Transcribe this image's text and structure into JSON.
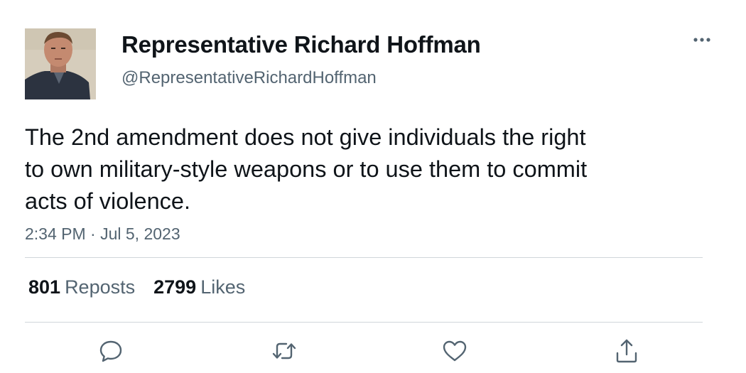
{
  "author": {
    "display_name": "Representative Richard Hoffman",
    "handle": "@RepresentativeRichardHoffman",
    "avatar_icon": "profile-photo"
  },
  "tweet": {
    "text": "The 2nd amendment does not give individuals the right\nto own military-style weapons or to use them to commit\nacts of violence.",
    "timestamp": "2:34 PM · Jul 5, 2023"
  },
  "stats": {
    "reposts_count": "801",
    "reposts_label": "Reposts",
    "likes_count": "2799",
    "likes_label": "Likes"
  },
  "actions": [
    {
      "name": "reply",
      "icon": "speech-bubble-icon"
    },
    {
      "name": "repost",
      "icon": "repost-arrows-icon"
    },
    {
      "name": "like",
      "icon": "heart-icon"
    },
    {
      "name": "share",
      "icon": "share-upload-icon"
    }
  ],
  "menu_icon": "more-horizontal-icon",
  "colors": {
    "text_primary": "#0f1419",
    "text_secondary": "#536471",
    "divider": "#d0d6da"
  }
}
